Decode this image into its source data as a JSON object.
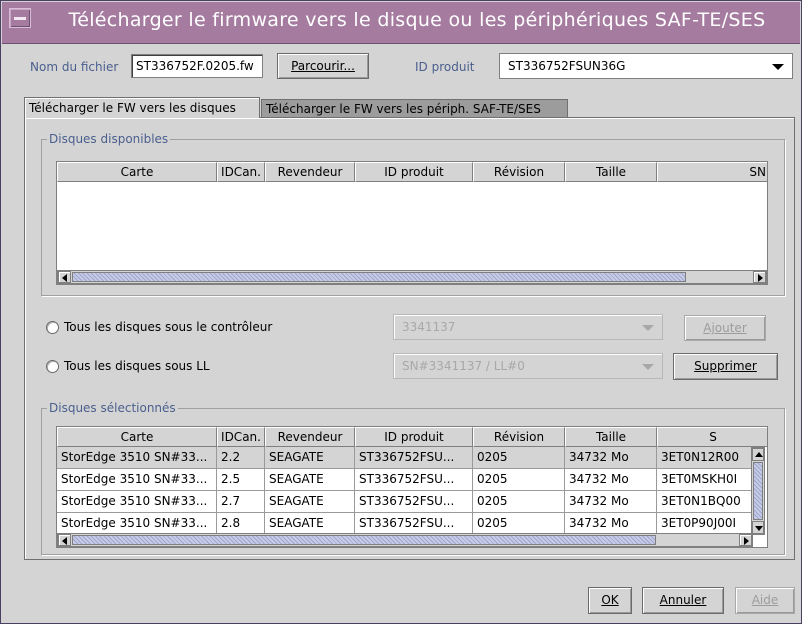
{
  "window": {
    "title": "Télécharger le firmware vers le disque ou les périphériques SAF-TE/SES"
  },
  "file": {
    "name_label": "Nom du fichier",
    "name_value": "ST336752F.0205.fw",
    "browse_label": "Parcourir...",
    "product_label": "ID produit",
    "product_value": "ST336752FSUN36G"
  },
  "tabs": [
    {
      "label": "Télécharger le FW vers les disques",
      "active": true
    },
    {
      "label": "Télécharger le FW vers les périph. SAF-TE/SES",
      "active": false
    }
  ],
  "available": {
    "title": "Disques disponibles",
    "columns": [
      "Carte",
      "IDCan.",
      "Revendeur",
      "ID produit",
      "Révision",
      "Taille",
      "SN"
    ]
  },
  "options": {
    "controller_label": "Tous les disques sous le contrôleur",
    "controller_value": "3341137",
    "add_label": "Ajouter",
    "ll_label": "Tous les disques sous LL",
    "ll_value": "SN#3341137 / LL#0",
    "remove_label": "Supprimer"
  },
  "selected": {
    "title": "Disques sélectionnés",
    "columns": [
      "Carte",
      "IDCan.",
      "Revendeur",
      "ID produit",
      "Révision",
      "Taille",
      "S"
    ],
    "rows": [
      [
        "StorEdge 3510 SN#33...",
        "2.2",
        "SEAGATE",
        "ST336752FSU...",
        "0205",
        "34732 Mo",
        "3ET0N12R00"
      ],
      [
        "StorEdge 3510 SN#33...",
        "2.5",
        "SEAGATE",
        "ST336752FSU...",
        "0205",
        "34732 Mo",
        "3ET0MSKH0I"
      ],
      [
        "StorEdge 3510 SN#33...",
        "2.7",
        "SEAGATE",
        "ST336752FSU...",
        "0205",
        "34732 Mo",
        "3ET0N1BQ00"
      ],
      [
        "StorEdge 3510 SN#33...",
        "2.8",
        "SEAGATE",
        "ST336752FSU...",
        "0205",
        "34732 Mo",
        "3ET0P90J00I"
      ]
    ]
  },
  "footer": {
    "ok_label": "OK",
    "cancel_label": "Annuler",
    "help_label": "Aide"
  }
}
